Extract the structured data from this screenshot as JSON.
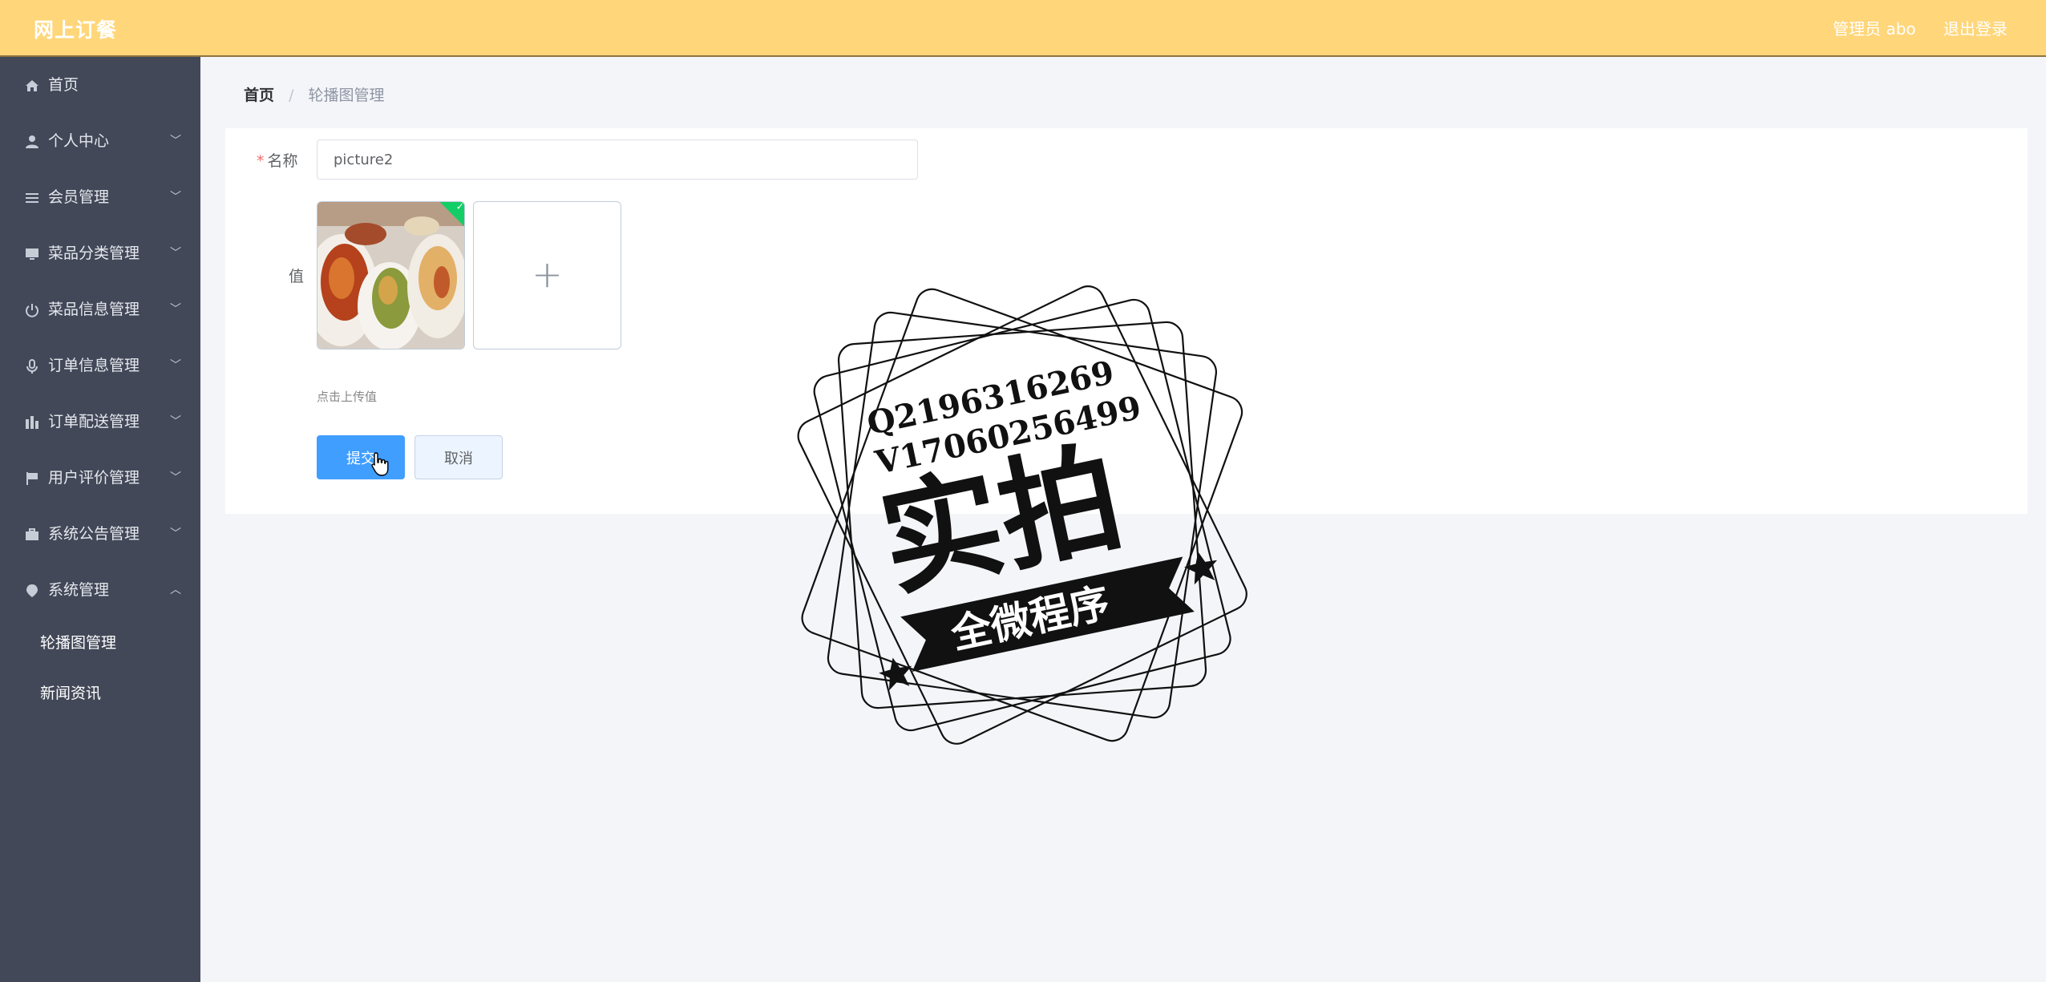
{
  "header": {
    "app_title": "网上订餐",
    "admin_label": "管理员 abo",
    "logout_label": "退出登录"
  },
  "sidebar": {
    "items": [
      {
        "label": "首页",
        "icon": "home-icon",
        "has_chevron": false
      },
      {
        "label": "个人中心",
        "icon": "user-icon",
        "has_chevron": true
      },
      {
        "label": "会员管理",
        "icon": "list-icon",
        "has_chevron": true
      },
      {
        "label": "菜品分类管理",
        "icon": "monitor-icon",
        "has_chevron": true
      },
      {
        "label": "菜品信息管理",
        "icon": "power-icon",
        "has_chevron": true
      },
      {
        "label": "订单信息管理",
        "icon": "microphone-icon",
        "has_chevron": true
      },
      {
        "label": "订单配送管理",
        "icon": "building-icon",
        "has_chevron": true
      },
      {
        "label": "用户评价管理",
        "icon": "flag-icon",
        "has_chevron": true
      },
      {
        "label": "系统公告管理",
        "icon": "briefcase-icon",
        "has_chevron": true
      },
      {
        "label": "系统管理",
        "icon": "location-icon",
        "has_chevron": true,
        "expanded": true
      }
    ],
    "submenu": [
      {
        "label": "轮播图管理"
      },
      {
        "label": "新闻资讯"
      }
    ]
  },
  "breadcrumb": {
    "home": "首页",
    "separator": "/",
    "current": "轮播图管理"
  },
  "form": {
    "name_label": "名称",
    "required_mark": "*",
    "name_value": "picture2",
    "value_label": "值",
    "upload_hint": "点击上传值",
    "upload_plus": "+",
    "success_mark": "✓",
    "submit_label": "提交",
    "cancel_label": "取消"
  },
  "watermark": {
    "line1": "Q2196316269",
    "line2": "V17060256499",
    "big_text": "实拍",
    "ribbon_text": "全微程序"
  },
  "colors": {
    "header_bg": "#ffd67a",
    "sidebar_bg": "#424858",
    "primary": "#409eff",
    "success": "#13ce66",
    "required": "#f56c6c"
  }
}
